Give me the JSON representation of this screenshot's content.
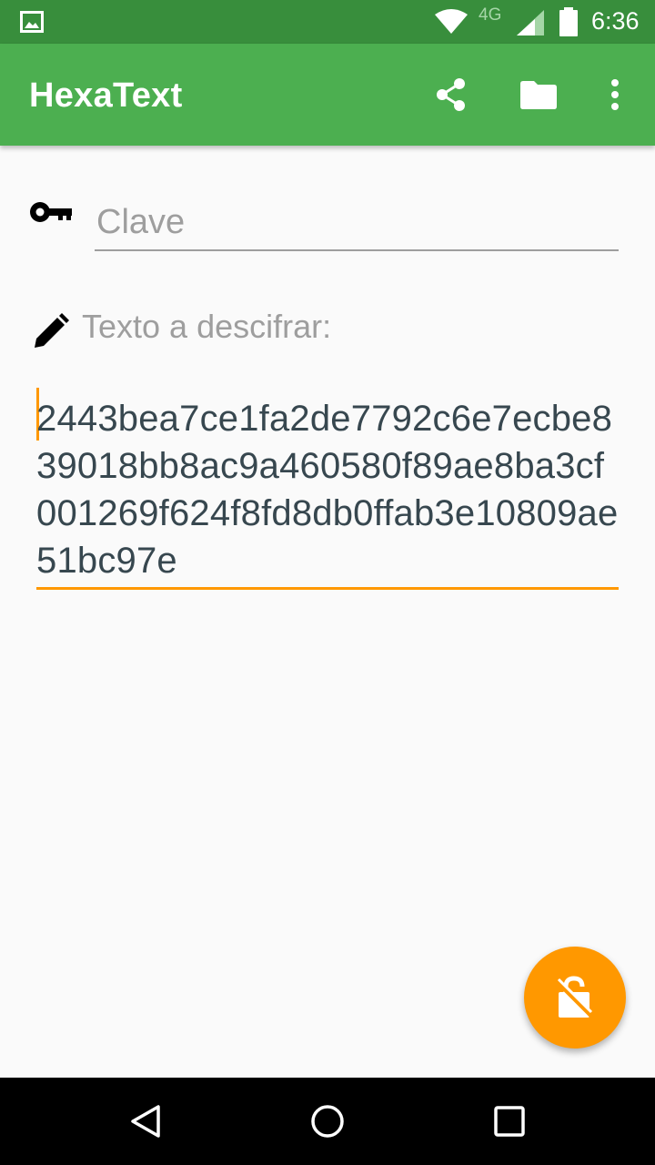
{
  "status_bar": {
    "network_label": "4G",
    "time": "6:36",
    "icons": [
      "image-icon",
      "wifi-icon",
      "signal-icon",
      "battery-icon"
    ]
  },
  "app_bar": {
    "title": "HexaText",
    "actions": [
      "share-icon",
      "folder-icon",
      "more-vert-icon"
    ]
  },
  "key_field": {
    "placeholder": "Clave",
    "value": "",
    "icon": "key-icon"
  },
  "cipher_section": {
    "label": "Texto a descifrar:",
    "icon": "pencil-icon",
    "value": "2443bea7ce1fa2de7792c6e7ecbe839018bb8ac9a460580f89ae8ba3cf001269f624f8fd8db0ffab3e10809ae51bc97e"
  },
  "fab": {
    "icon": "lock-open-icon"
  },
  "nav_bar": {
    "buttons": [
      "back-icon",
      "home-icon",
      "recents-icon"
    ]
  },
  "colors": {
    "status_bar": "#388e3c",
    "app_bar": "#4caf50",
    "accent": "#ff9800",
    "background": "#fafafa",
    "hint_text": "#9e9e9e",
    "body_text": "#37474f"
  }
}
